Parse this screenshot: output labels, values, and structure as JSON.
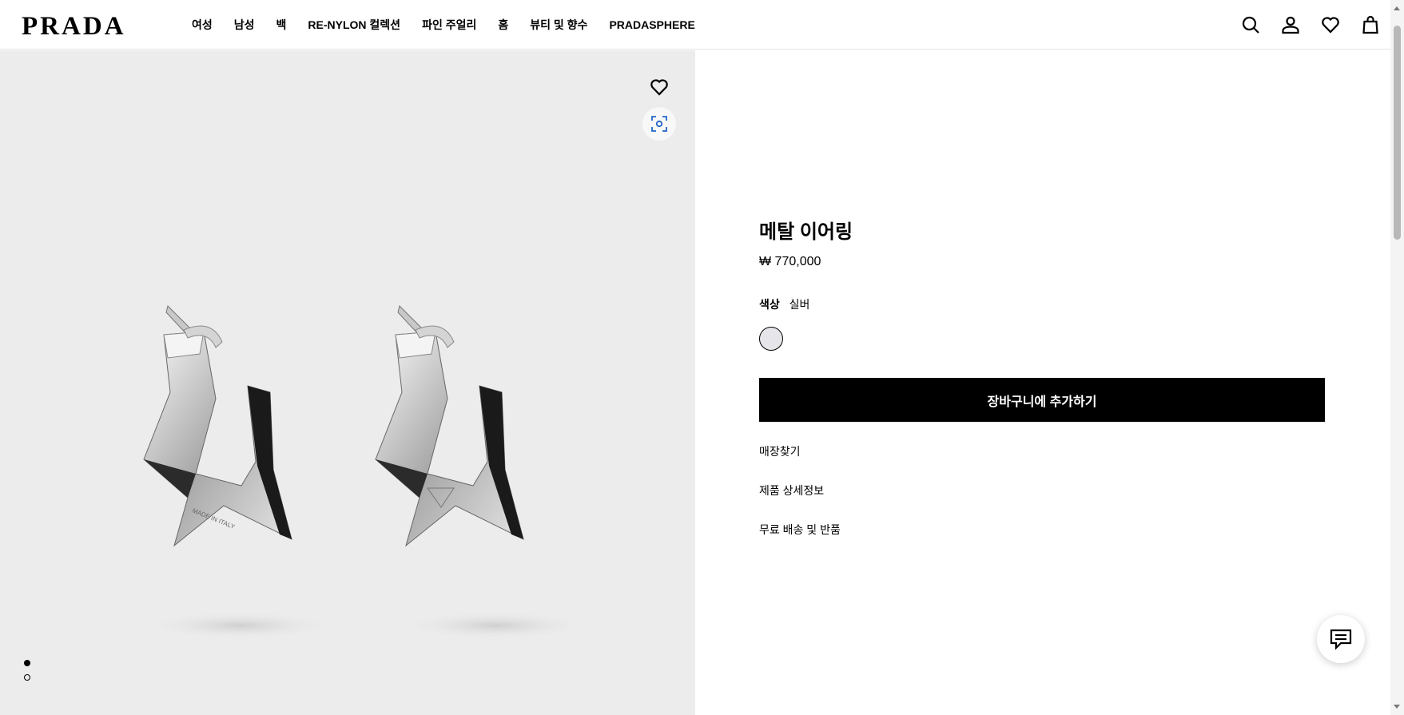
{
  "header": {
    "logo": "PRADA",
    "nav": [
      "여성",
      "남성",
      "백",
      "RE-NYLON 컬렉션",
      "파인 주얼리",
      "홈",
      "뷰티 및 향수",
      "PRADASPHERE"
    ],
    "icons": [
      "search-icon",
      "account-icon",
      "wishlist-icon",
      "bag-icon"
    ]
  },
  "gallery": {
    "image_dots": [
      {
        "state": "active"
      },
      {
        "state": "inactive"
      }
    ],
    "engraving": "MADE IN ITALY"
  },
  "product": {
    "title": "메탈 이어링",
    "price": "₩ 770,000",
    "color_label": "색상",
    "color_value": "실버",
    "add_to_cart": "장바구니에 추가하기",
    "links": [
      "매장찾기",
      "제품 상세정보",
      "무료 배송 및 반품"
    ]
  },
  "colors": {
    "accent": "#000000",
    "gallery_bg": "#ececec",
    "swatch_silver": "#e6e6ea"
  }
}
